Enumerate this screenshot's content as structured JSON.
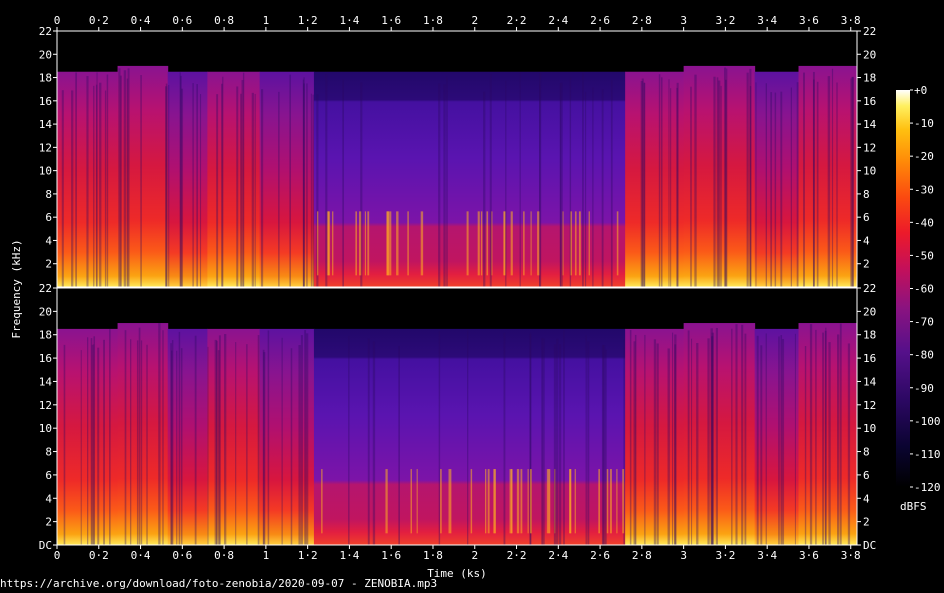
{
  "chart_data": {
    "type": "heatmap",
    "xlabel": "Time (ks)",
    "ylabel": "Frequency (kHz)",
    "x_ticks": [
      "0",
      "0·2",
      "0·4",
      "0·6",
      "0·8",
      "1",
      "1·2",
      "1·4",
      "1·6",
      "1·8",
      "2",
      "2·2",
      "2·4",
      "2·6",
      "2·8",
      "3",
      "3·2",
      "3·4",
      "3·6",
      "3·8"
    ],
    "x_tick_values": [
      0,
      0.2,
      0.4,
      0.6,
      0.8,
      1.0,
      1.2,
      1.4,
      1.6,
      1.8,
      2.0,
      2.2,
      2.4,
      2.6,
      2.8,
      3.0,
      3.2,
      3.4,
      3.6,
      3.8
    ],
    "xlim": [
      0,
      3.83
    ],
    "y_ticks_top": [
      "22",
      "20",
      "18",
      "16",
      "14",
      "12",
      "10",
      "8",
      "6",
      "4",
      "2"
    ],
    "y_ticks_bottom": [
      "22",
      "20",
      "18",
      "16",
      "14",
      "12",
      "10",
      "8",
      "6",
      "4",
      "2",
      "DC"
    ],
    "y_tick_values": [
      22,
      20,
      18,
      16,
      14,
      12,
      10,
      8,
      6,
      4,
      2,
      0
    ],
    "ylim": [
      0,
      22
    ],
    "channels": 2,
    "colorbar": {
      "label": "dBFS",
      "ticks": [
        "+0",
        "-10",
        "-20",
        "-30",
        "-40",
        "-50",
        "-60",
        "-70",
        "-80",
        "-90",
        "-100",
        "-110",
        "-120"
      ],
      "tick_values": [
        0,
        -10,
        -20,
        -30,
        -40,
        -50,
        -60,
        -70,
        -80,
        -90,
        -100,
        -110,
        -120
      ],
      "range": [
        -120,
        0
      ]
    },
    "segments": [
      {
        "start": 0.0,
        "end": 0.29,
        "cutoff_khz": 18.5,
        "level": "loud"
      },
      {
        "start": 0.29,
        "end": 0.53,
        "cutoff_khz": 19.0,
        "level": "loud"
      },
      {
        "start": 0.53,
        "end": 0.72,
        "cutoff_khz": 18.5,
        "level": "medium"
      },
      {
        "start": 0.72,
        "end": 0.97,
        "cutoff_khz": 18.5,
        "level": "loud"
      },
      {
        "start": 0.97,
        "end": 1.23,
        "cutoff_khz": 18.5,
        "level": "medium"
      },
      {
        "start": 1.23,
        "end": 2.72,
        "cutoff_khz": 18.5,
        "level": "quiet"
      },
      {
        "start": 2.72,
        "end": 3.0,
        "cutoff_khz": 18.5,
        "level": "loud"
      },
      {
        "start": 3.0,
        "end": 3.34,
        "cutoff_khz": 19.0,
        "level": "loud"
      },
      {
        "start": 3.34,
        "end": 3.55,
        "cutoff_khz": 18.5,
        "level": "medium"
      },
      {
        "start": 3.55,
        "end": 3.83,
        "cutoff_khz": 19.0,
        "level": "loud"
      }
    ]
  },
  "source_caption": "https://archive.org/download/foto-zenobia/2020-09-07 - ZENOBIA.mp3"
}
